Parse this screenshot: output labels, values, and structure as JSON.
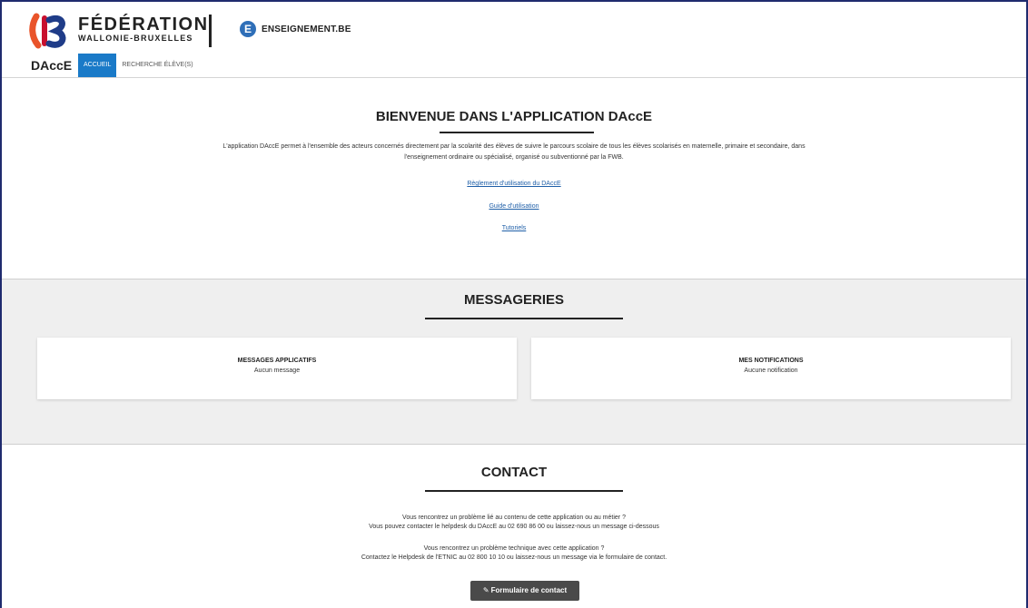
{
  "header": {
    "fwb_title": "FÉDÉRATION",
    "fwb_subtitle": "WALLONIE-BRUXELLES",
    "ens_icon_letter": "E",
    "ens_label": "ENSEIGNEMENT.BE",
    "app_name": "DAccE",
    "nav": [
      {
        "label": "ACCUEIL",
        "active": true
      },
      {
        "label": "RECHERCHE ÉLÈVE(S)",
        "active": false
      }
    ]
  },
  "welcome": {
    "title": "BIENVENUE DANS L'APPLICATION DAccE",
    "paragraph_line1": "L'application DAccE permet à l'ensemble des acteurs concernés directement par la scolarité des élèves de suivre le parcours scolaire de tous les élèves scolarisés en maternelle, primaire et secondaire, dans",
    "paragraph_line2": "l'enseignement ordinaire ou spécialisé, organisé ou subventionné par la FWB.",
    "links": {
      "reglement": "Règlement d'utilisation du DAccE",
      "guide": "Guide d'utilisation",
      "tutoriels": "Tutoriels"
    }
  },
  "messageries": {
    "title": "MESSAGERIES",
    "cards": [
      {
        "title": "MESSAGES APPLICATIFS",
        "status": "Aucun message"
      },
      {
        "title": "MES NOTIFICATIONS",
        "status": "Aucune notification"
      }
    ]
  },
  "contact": {
    "title": "CONTACT",
    "line1": "Vous rencontrez un problème lié au contenu de cette application ou au métier ?",
    "line2": "Vous pouvez contacter le helpdesk du DAccE au 02 690 86 00 ou laissez-nous un message ci-dessous",
    "line3": "Vous rencontrez un problème technique avec cette application ?",
    "line4": "Contactez le Helpdesk de l'ETNIC au 02 800 10 10 ou laissez-nous un message via le formulaire de contact.",
    "button_label": "Formulaire de contact"
  },
  "colors": {
    "accent": "#1a7ac8",
    "link": "#1f5fa8",
    "frame": "#1f2b6e",
    "button": "#4a4a4a",
    "logo_orange": "#e9542a",
    "logo_red": "#c8102e",
    "logo_blue": "#1f3c88"
  },
  "icons": [
    "fwb-logo-icon",
    "enseignement-e-icon",
    "edit-icon"
  ]
}
